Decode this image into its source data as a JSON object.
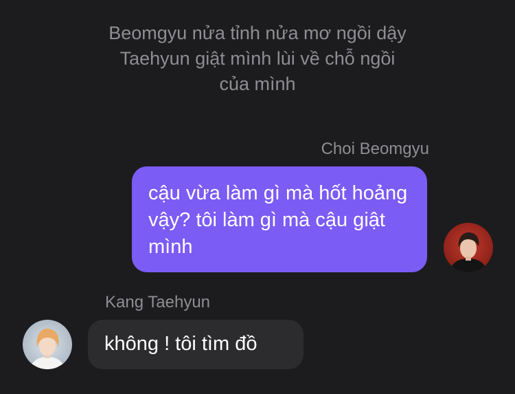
{
  "narration": {
    "lines": [
      "Beomgyu nửa tỉnh nửa mơ ngồi dậy",
      "Taehyun giật mình lùi về chỗ ngồi",
      "của mình"
    ]
  },
  "messages": [
    {
      "sender": "Choi Beomgyu",
      "text": "cậu vừa làm gì mà hốt hoảng vậy? tôi làm gì mà cậu giật mình",
      "side": "right",
      "avatar": "avatar-choi-beomgyu"
    },
    {
      "sender": "Kang Taehyun",
      "text": "không ! tôi tìm đồ",
      "side": "left",
      "avatar": "avatar-kang-taehyun"
    }
  ],
  "colors": {
    "background": "#1c1c1e",
    "outgoing_bubble": "#7b5cf5",
    "incoming_bubble": "#2c2c2e",
    "secondary_text": "#8e8e93"
  }
}
